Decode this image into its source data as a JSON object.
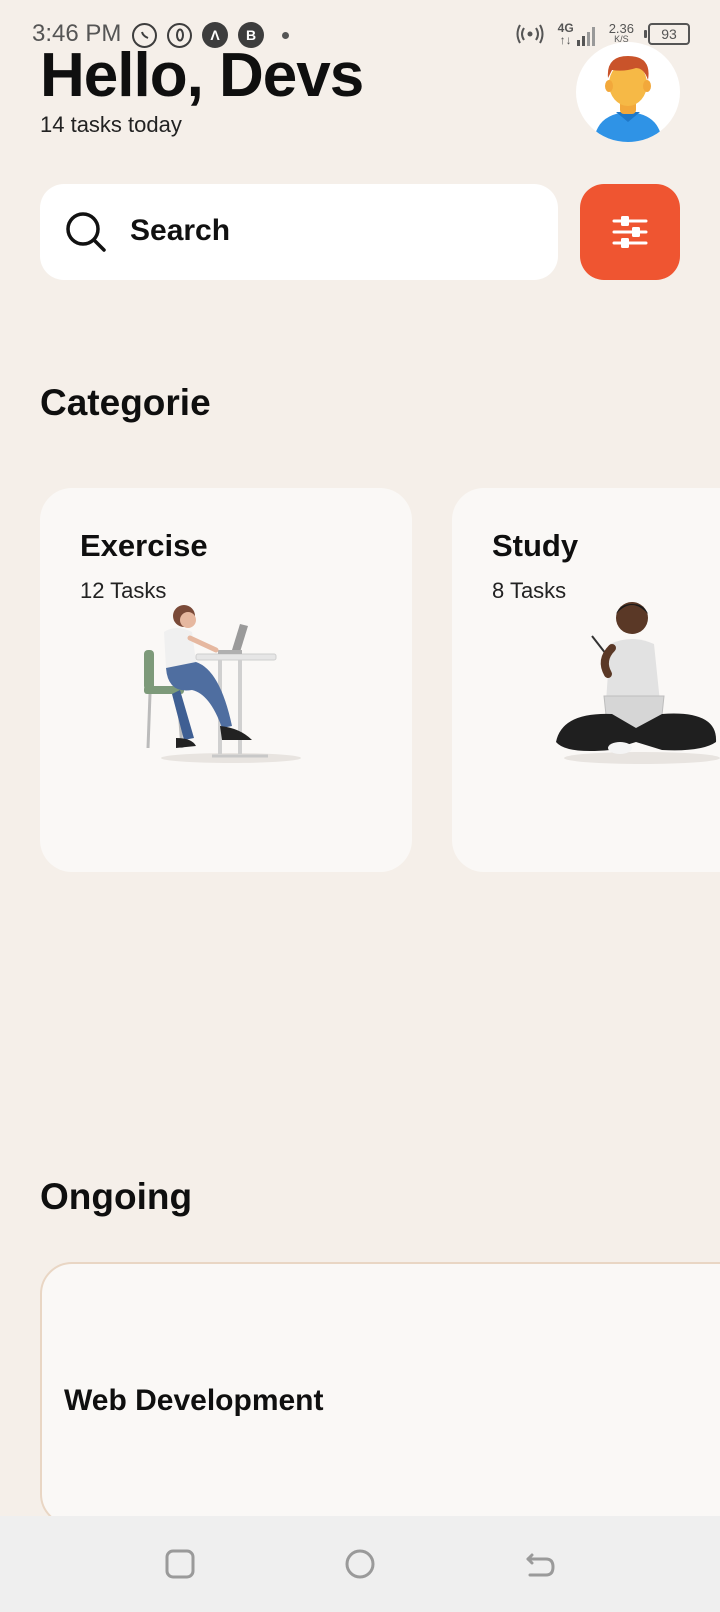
{
  "status_bar": {
    "time": "3:46 PM",
    "icons_left": [
      "whatsapp-icon",
      "opera-icon",
      "app-a-icon",
      "app-b-icon"
    ],
    "app_a_letter": "Λ",
    "app_b_letter": "B",
    "network": "4G",
    "network_arrows": "↑↓",
    "speed_value": "2.36",
    "speed_unit": "K/S",
    "battery": "93"
  },
  "header": {
    "greeting": "Hello, Devs",
    "subtitle": "14 tasks today"
  },
  "search": {
    "label": "Search"
  },
  "colors": {
    "background": "#f5efe9",
    "accent": "#ef5531",
    "card": "#faf8f6"
  },
  "sections": {
    "categories_title": "Categorie",
    "ongoing_title": "Ongoing"
  },
  "categories": [
    {
      "title": "Exercise",
      "count": "12 Tasks",
      "illustration": "woman-at-desk-illustration"
    },
    {
      "title": "Study",
      "count": "8 Tasks",
      "illustration": "man-sitting-with-laptop-illustration"
    }
  ],
  "ongoing": [
    {
      "title": "Web Development"
    }
  ],
  "nav_bar": {
    "buttons": [
      "recent-apps-icon",
      "home-icon",
      "back-icon"
    ]
  }
}
